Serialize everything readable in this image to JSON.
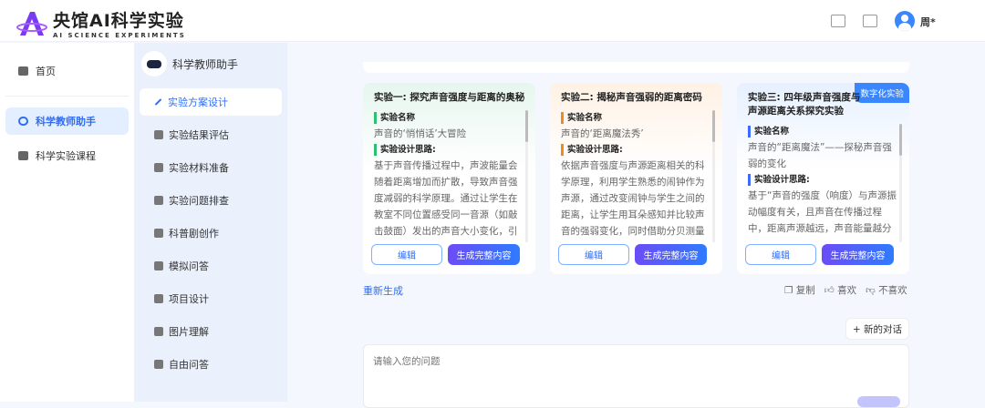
{
  "header": {
    "app_title": "央馆AI科学实验",
    "app_subtitle": "AI SCIENCE EXPERIMENTS",
    "user_name": "周*"
  },
  "sidebar": {
    "items": [
      {
        "label": "首页",
        "icon": "home-icon"
      },
      {
        "label": "科学教师助手",
        "icon": "robot-icon",
        "active": true
      },
      {
        "label": "科学实验课程",
        "icon": "monitor-icon"
      }
    ]
  },
  "assistant": {
    "title": "科学教师助手",
    "items": [
      {
        "label": "实验方案设计",
        "active": true
      },
      {
        "label": "实验结果评估"
      },
      {
        "label": "实验材料准备"
      },
      {
        "label": "实验问题排查"
      },
      {
        "label": "科普剧创作"
      },
      {
        "label": "模拟问答"
      },
      {
        "label": "项目设计"
      },
      {
        "label": "图片理解"
      },
      {
        "label": "自由问答"
      }
    ]
  },
  "cards": [
    {
      "title": "实验一: 探究声音强度与距离的奥秘",
      "name_label": "实验名称",
      "name": "声音的‘悄悄话’大冒险",
      "idea_label": "实验设计思路:",
      "idea": "基于声音传播过程中，声波能量会随着距离增加而扩散，导致声音强度减弱的科学原理。通过让学生在教室不同位置感受同一音源（如敲击鼓面）发出的声音大小变化，引",
      "edit": "编辑",
      "generate": "生成完整内容"
    },
    {
      "title": "实验二: 揭秘声音强弱的距离密码",
      "name_label": "实验名称",
      "name": "声音的‘距离魔法秀’",
      "idea_label": "实验设计思路:",
      "idea": "依据声音强度与声源距离相关的科学原理，利用学生熟悉的闹钟作为声源，通过改变闹钟与学生之间的距离，让学生用耳朵感知并比较声音的强弱变化，同时借助分贝测量",
      "edit": "编辑",
      "generate": "生成完整内容"
    },
    {
      "title": "实验三: 四年级声音强度与声源距离关系探究实验",
      "tag": "数字化实验",
      "name_label": "实验名称",
      "name": "声音的“距离魔法”——探秘声音强弱的变化",
      "idea_label": "实验设计思路:",
      "idea": "基于“声音的强度（响度）与声源振动幅度有关，且声音在传播过程中，距离声源越远，声音能量越分",
      "edit": "编辑",
      "generate": "生成完整内容"
    }
  ],
  "actions": {
    "regenerate": "重新生成",
    "copy": "复制",
    "like": "喜欢",
    "dislike": "不喜欢",
    "new_chat": "+ 新的对话"
  },
  "input": {
    "placeholder": "请输入您的问题"
  }
}
